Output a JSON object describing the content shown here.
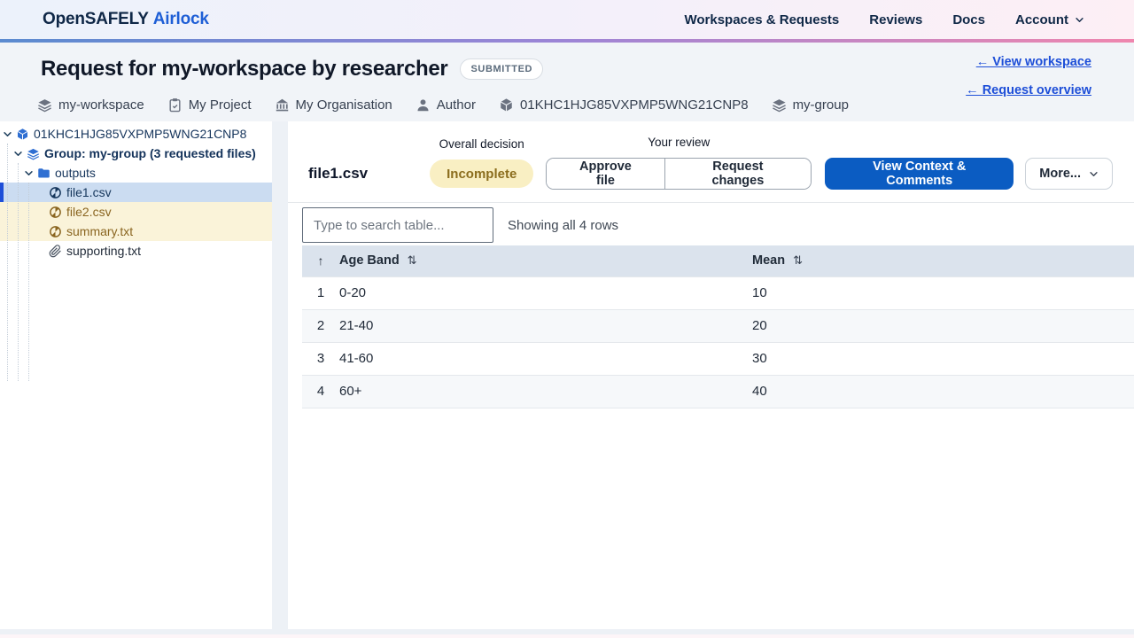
{
  "nav": {
    "brand": {
      "part1": "OpenSAFELY",
      "part2": "Airlock"
    },
    "items": [
      {
        "label": "Workspaces & Requests"
      },
      {
        "label": "Reviews"
      },
      {
        "label": "Docs"
      }
    ],
    "account_label": "Account"
  },
  "header": {
    "title": "Request for my-workspace by researcher",
    "status_badge": "SUBMITTED",
    "meta": [
      {
        "icon": "layers-icon",
        "label": "my-workspace"
      },
      {
        "icon": "clipboard-icon",
        "label": "My Project"
      },
      {
        "icon": "building-icon",
        "label": "My Organisation"
      },
      {
        "icon": "user-icon",
        "label": "Author"
      },
      {
        "icon": "cube-icon",
        "label": "01KHC1HJG85VXPMP5WNG21CNP8"
      },
      {
        "icon": "layers-icon",
        "label": "my-group"
      }
    ],
    "links": [
      {
        "label": "← View workspace"
      },
      {
        "label": "← Request overview"
      }
    ]
  },
  "sidebar": {
    "tree": [
      {
        "level": 0,
        "icon": "cube-icon",
        "label": "01KHC1HJG85VXPMP5WNG21CNP8",
        "expanded": true
      },
      {
        "level": 1,
        "icon": "layers-icon",
        "label": "Group: my-group (3 requested files)",
        "expanded": true
      },
      {
        "level": 2,
        "icon": "folder-icon",
        "label": "outputs",
        "expanded": true
      },
      {
        "level": 3,
        "icon": "csv-file-icon",
        "label": "file1.csv",
        "state": "selected"
      },
      {
        "level": 3,
        "icon": "csv-file-icon",
        "label": "file2.csv",
        "state": "changes-requested"
      },
      {
        "level": 3,
        "icon": "csv-file-icon",
        "label": "summary.txt",
        "state": "changes-requested"
      },
      {
        "level": 3,
        "icon": "paperclip-icon",
        "label": "supporting.txt",
        "state": "none"
      }
    ]
  },
  "content": {
    "file_title": "file1.csv",
    "overall_decision_label": "Overall decision",
    "decision_value": "Incomplete",
    "your_review_label": "Your review",
    "approve_label": "Approve file",
    "request_changes_label": "Request changes",
    "view_context_label": "View Context & Comments",
    "more_label": "More...",
    "search_placeholder": "Type to search table...",
    "rows_status": "Showing all 4 rows"
  },
  "table": {
    "columns": [
      "Age Band",
      "Mean"
    ],
    "rows": [
      [
        "0-20",
        "10"
      ],
      [
        "21-40",
        "20"
      ],
      [
        "41-60",
        "30"
      ],
      [
        "60+",
        "40"
      ]
    ]
  },
  "icons": {
    "sort_both": "⇅",
    "sort_up": "↑"
  },
  "colors": {
    "primary_blue": "#0b5cc2",
    "link_blue": "#1d4ed8",
    "selected_row_bg": "#cbdcf1",
    "warn_row_bg": "#faf3d9",
    "warn_text": "#8a6520",
    "decision_pill_bg": "#f9efc3",
    "decision_pill_text": "#8b6d1d",
    "table_header_bg": "#dbe3ed",
    "gradient": [
      "#5b8bd0",
      "#9d85d6",
      "#ef86ae"
    ]
  }
}
